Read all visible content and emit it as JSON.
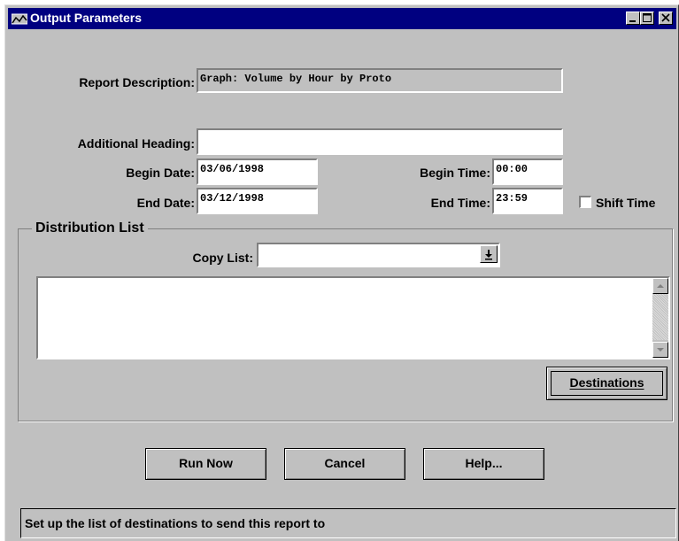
{
  "window": {
    "title": "Output Parameters",
    "icons": [
      "app-icon",
      "minimize-icon",
      "maximize-icon",
      "close-icon"
    ]
  },
  "form": {
    "report_description_label": "Report Description:",
    "report_description_value": "Graph: Volume by Hour by Proto",
    "additional_heading_label": "Additional Heading:",
    "additional_heading_value": "",
    "begin_date_label": "Begin Date:",
    "begin_date_value": "03/06/1998",
    "end_date_label": "End Date:",
    "end_date_value": "03/12/1998",
    "begin_time_label": "Begin Time:",
    "begin_time_value": "00:00",
    "end_time_label": "End Time:",
    "end_time_value": "23:59",
    "shift_time_label": "Shift Time",
    "shift_time_checked": false
  },
  "distribution": {
    "group_title": "Distribution List",
    "copy_list_label": "Copy List:",
    "copy_list_value": "",
    "destinations_button": "Destinations",
    "list_items": []
  },
  "buttons": {
    "run_now": "Run Now",
    "cancel": "Cancel",
    "help": "Help..."
  },
  "status": {
    "text": "Set up the list of destinations to send this report to"
  },
  "colors": {
    "titlebar": "#000080",
    "face": "#c0c0c0"
  }
}
